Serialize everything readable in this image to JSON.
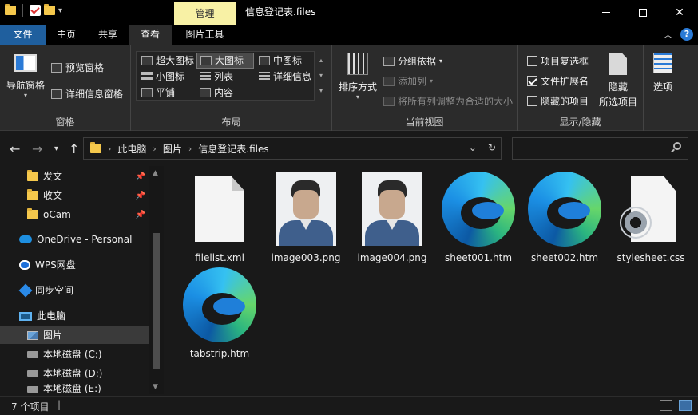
{
  "window": {
    "context_tab": "管理",
    "title": "信息登记表.files"
  },
  "ribbon_tabs": [
    "文件",
    "主页",
    "共享",
    "查看",
    "图片工具"
  ],
  "ribbon": {
    "pane": {
      "label": "窗格",
      "nav_pane": "导航窗格",
      "preview": "预览窗格",
      "details": "详细信息窗格"
    },
    "layout": {
      "label": "布局",
      "items": [
        "超大图标",
        "大图标",
        "中图标",
        "小图标",
        "列表",
        "详细信息",
        "平铺",
        "内容"
      ]
    },
    "current_view": {
      "label": "当前视图",
      "sort": "排序方式",
      "group_by": "分组依据",
      "add_column": "添加列",
      "fit_columns": "将所有列调整为合适的大小"
    },
    "show_hide": {
      "label": "显示/隐藏",
      "item_checkboxes": "项目复选框",
      "file_extensions": "文件扩展名",
      "hidden_items": "隐藏的项目",
      "hide_selected_line1": "隐藏",
      "hide_selected_line2": "所选项目"
    },
    "options": "选项"
  },
  "breadcrumb": [
    "此电脑",
    "图片",
    "信息登记表.files"
  ],
  "nav_pane": {
    "items": [
      "发文",
      "收文",
      "oCam",
      "OneDrive - Personal",
      "WPS网盘",
      "同步空间",
      "此电脑",
      "图片",
      "本地磁盘 (C:)",
      "本地磁盘 (D:)",
      "本地磁盘 (E:)"
    ]
  },
  "files": [
    {
      "name": "filelist.xml",
      "icon": "document-icon"
    },
    {
      "name": "image003.png",
      "icon": "photo-icon"
    },
    {
      "name": "image004.png",
      "icon": "photo-icon"
    },
    {
      "name": "sheet001.htm",
      "icon": "edge-icon"
    },
    {
      "name": "sheet002.htm",
      "icon": "edge-icon"
    },
    {
      "name": "stylesheet.css",
      "icon": "css-icon"
    },
    {
      "name": "tabstrip.htm",
      "icon": "edge-icon"
    }
  ],
  "status": {
    "count": "7 个项目"
  },
  "colors": {
    "file_tab": "#1f5f9e",
    "context_tab": "#f8f1a5",
    "background": "#191919"
  }
}
